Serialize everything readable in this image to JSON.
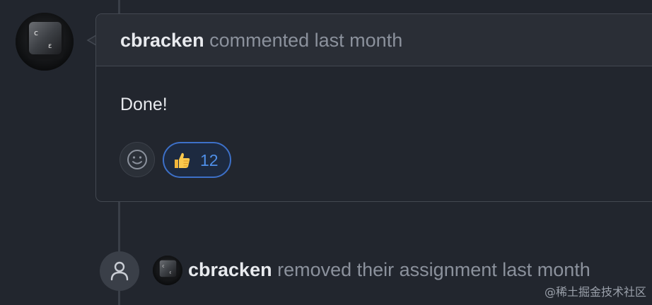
{
  "comment": {
    "author": "cbracken",
    "action": "commented last month",
    "body": "Done!",
    "reactions": [
      {
        "emoji": "thumbs-up",
        "count": "12",
        "active": true
      }
    ],
    "add_reaction_icon": "smiley-icon"
  },
  "event": {
    "icon": "person-icon",
    "actor": "cbracken",
    "action": "removed their assignment last month"
  },
  "watermark": "@稀土掘金技术社区",
  "colors": {
    "background": "#22262e",
    "header_bg": "#2a2e36",
    "border": "#434851",
    "text_primary": "#e8eaee",
    "text_muted": "#8b919c",
    "reaction_active_border": "#3d70c8",
    "reaction_active_text": "#4f8fe8"
  }
}
